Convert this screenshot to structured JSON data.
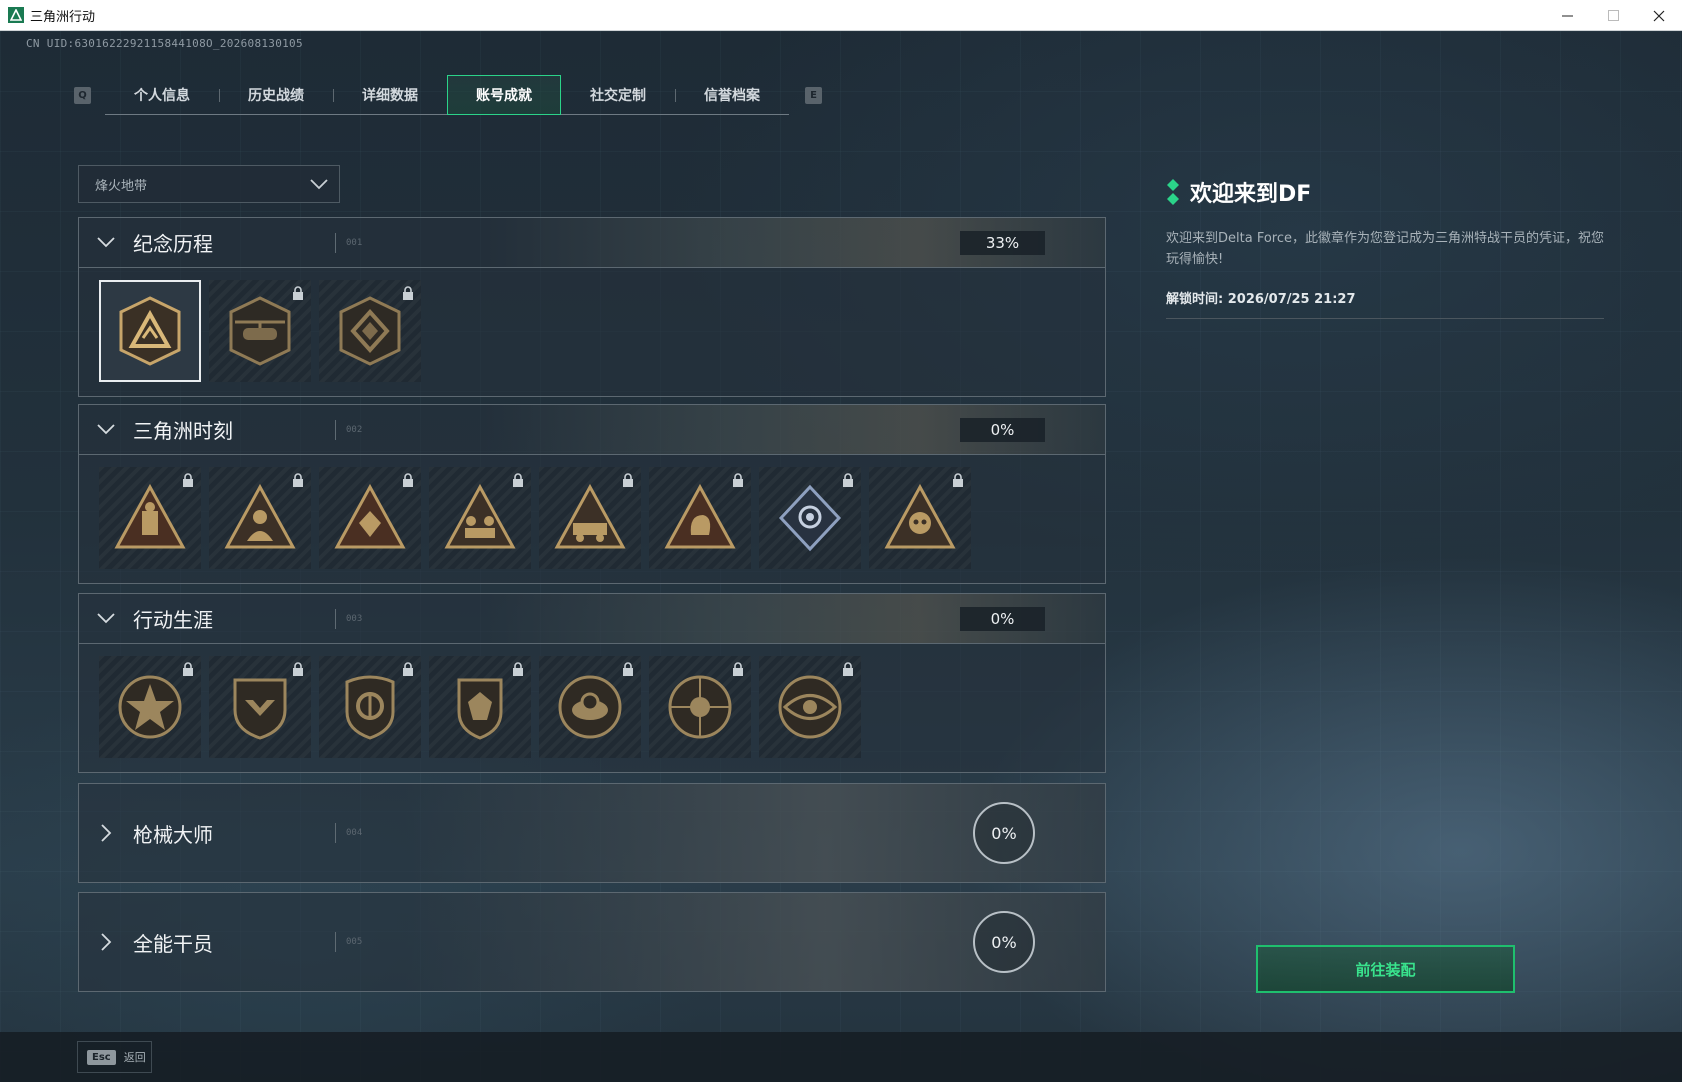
{
  "window": {
    "title": "三角洲行动"
  },
  "uid_text": "CN UID:6301622292115844108O_202608130105",
  "tabs": {
    "left_key": "Q",
    "right_key": "E",
    "items": [
      {
        "label": "个人信息",
        "active": false
      },
      {
        "label": "历史战绩",
        "active": false
      },
      {
        "label": "详细数据",
        "active": false
      },
      {
        "label": "账号成就",
        "active": true
      },
      {
        "label": "社交定制",
        "active": false
      },
      {
        "label": "信誉档案",
        "active": false
      }
    ]
  },
  "dropdown": {
    "selected": "烽火地带"
  },
  "sections": [
    {
      "title": "纪念历程",
      "index": "001",
      "progress": "33%",
      "expanded": true
    },
    {
      "title": "三角洲时刻",
      "index": "002",
      "progress": "0%",
      "expanded": true
    },
    {
      "title": "行动生涯",
      "index": "003",
      "progress": "0%",
      "expanded": true
    },
    {
      "title": "枪械大师",
      "index": "004",
      "progress": "0%",
      "expanded": false
    },
    {
      "title": "全能干员",
      "index": "005",
      "progress": "0%",
      "expanded": false
    }
  ],
  "detail": {
    "title": "欢迎来到DF",
    "description": "欢迎来到Delta Force，此徽章作为您登记成为三角洲特战干员的凭证，祝您玩得愉快!",
    "unlock_time": "解锁时间: 2026/07/25 21:27",
    "equip_button": "前往装配"
  },
  "footer": {
    "esc_key": "Esc",
    "back_label": "返回"
  },
  "colors": {
    "accent_green": "#2bd389",
    "button_text_green": "#39e38d",
    "badge_gold": "#b99a64"
  }
}
